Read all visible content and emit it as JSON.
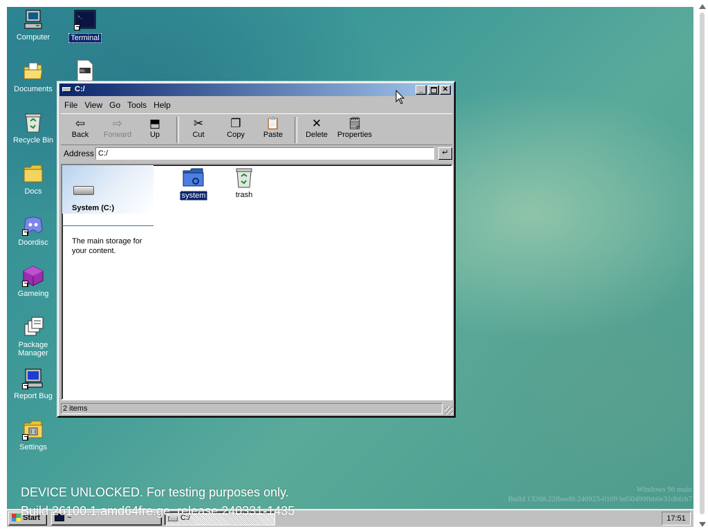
{
  "desktop": {
    "icons": [
      {
        "label": "Computer",
        "icon": "computer-icon"
      },
      {
        "label": "Terminal",
        "icon": "terminal-icon",
        "selected": true
      },
      {
        "label": "Documents",
        "icon": "documents-folder-icon"
      },
      {
        "label": "Recycle Bin",
        "icon": "recycle-bin-icon"
      },
      {
        "label": "Docs",
        "icon": "folder-icon"
      },
      {
        "label": "Doordisc",
        "icon": "discord-icon"
      },
      {
        "label": "Gameing",
        "icon": "cube-icon"
      },
      {
        "label": "Package Manager",
        "icon": "package-manager-icon"
      },
      {
        "label": "Report Bug",
        "icon": "report-bug-icon"
      },
      {
        "label": "Settings",
        "icon": "settings-icon"
      }
    ],
    "watermark": [
      "Windows 96 main",
      "Build 13268.22fbeef0:240923-0109 bd50499fbb0e31dbfcb7"
    ],
    "notice": [
      "DEVICE UNLOCKED. For testing purposes only.",
      "Build 26100.1.amd64fre.ge_release.240331-1435"
    ]
  },
  "window": {
    "title": "C:/",
    "menu": [
      "File",
      "View",
      "Go",
      "Tools",
      "Help"
    ],
    "toolbar": [
      {
        "label": "Back",
        "icon": "back-arrow-icon",
        "enabled": true
      },
      {
        "label": "Forward",
        "icon": "forward-arrow-icon",
        "enabled": false
      },
      {
        "label": "Up",
        "icon": "up-folder-icon",
        "enabled": true
      },
      {
        "label": "Cut",
        "icon": "scissors-icon",
        "enabled": true
      },
      {
        "label": "Copy",
        "icon": "copy-icon",
        "enabled": true
      },
      {
        "label": "Paste",
        "icon": "paste-icon",
        "enabled": true
      },
      {
        "label": "Delete",
        "icon": "delete-x-icon",
        "enabled": true
      },
      {
        "label": "Properties",
        "icon": "properties-icon",
        "enabled": true
      }
    ],
    "address_label": "Address",
    "address_value": "C:/",
    "info": {
      "title": "System (C:)",
      "description": "The main storage for your content."
    },
    "items": [
      {
        "label": "system",
        "icon": "system-folder-icon",
        "selected": true
      },
      {
        "label": "trash",
        "icon": "recycle-bin-icon",
        "selected": false
      }
    ],
    "status": "2 items"
  },
  "taskbar": {
    "start": "Start",
    "tasks": [
      {
        "label": "~",
        "icon": "terminal-icon",
        "active": false
      },
      {
        "label": "C:/",
        "icon": "drive-icon",
        "active": true
      }
    ],
    "clock": "17:51"
  },
  "colors": {
    "title_active": "#0a246a",
    "title_fade": "#a6caf0",
    "face": "#c0c0c0",
    "desktop": "#3f9a98"
  }
}
